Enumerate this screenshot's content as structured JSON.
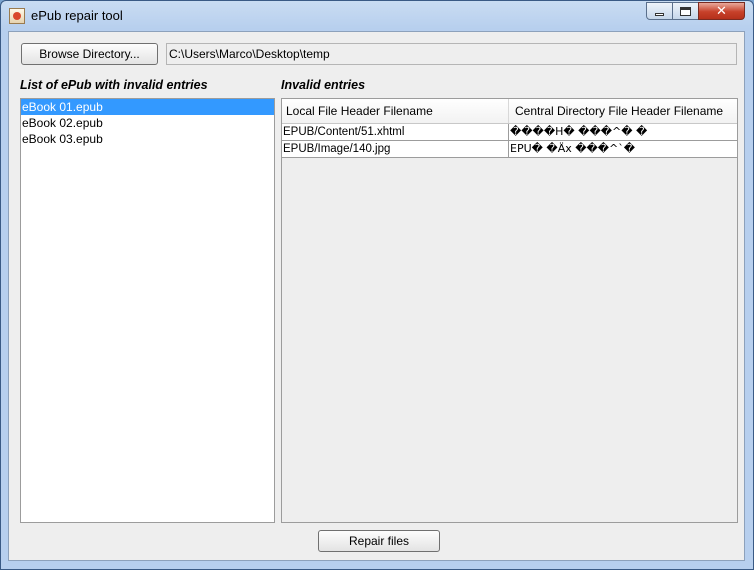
{
  "window": {
    "title": "ePub repair tool",
    "controls": {
      "minimize": "minimize",
      "maximize": "maximize",
      "close": "✕"
    }
  },
  "toolbar": {
    "browse_label": "Browse Directory...",
    "path_value": "C:\\Users\\Marco\\Desktop\\temp"
  },
  "epub_list": {
    "label": "List of ePub with invalid entries",
    "items": [
      {
        "name": "eBook 01.epub",
        "selected": true
      },
      {
        "name": "eBook 02.epub",
        "selected": false
      },
      {
        "name": "eBook 03.epub",
        "selected": false
      }
    ]
  },
  "invalid_entries": {
    "label": "Invalid entries",
    "columns": [
      "Local File Header Filename",
      "Central Directory File Header Filename"
    ],
    "rows": [
      [
        "EPUB/Content/51.xhtml",
        "����H�   ���^�  �"
      ],
      [
        "EPUB/Image/140.jpg",
        "EPU�  �Äx    ���^`�"
      ]
    ]
  },
  "actions": {
    "repair_label": "Repair files"
  },
  "colors": {
    "selection": "#3399ff",
    "close_button": "#c7412a",
    "panel": "#eeeeee"
  },
  "icons": [
    "java-app-icon",
    "minimize-icon",
    "maximize-icon",
    "close-icon"
  ]
}
